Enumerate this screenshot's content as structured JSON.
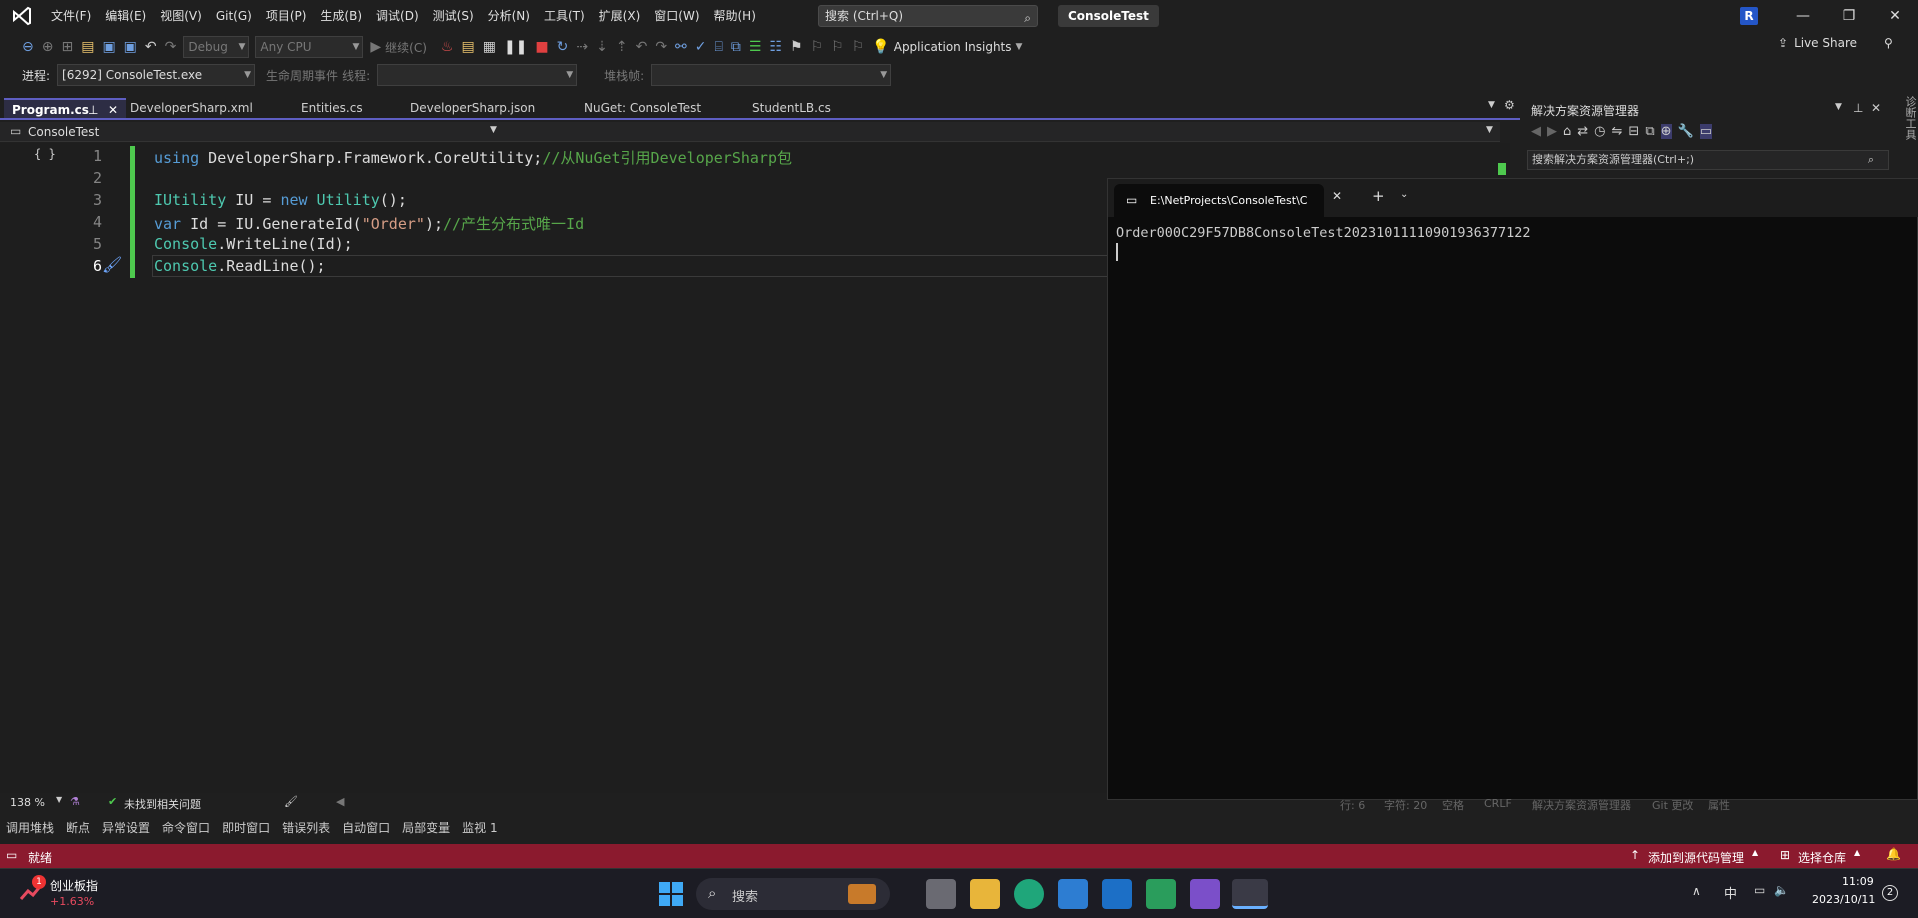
{
  "menu": [
    "文件(F)",
    "编辑(E)",
    "视图(V)",
    "Git(G)",
    "项目(P)",
    "生成(B)",
    "调试(D)",
    "测试(S)",
    "分析(N)",
    "工具(T)",
    "扩展(X)",
    "窗口(W)",
    "帮助(H)"
  ],
  "search": {
    "label": "搜索 (Ctrl+Q)"
  },
  "project_name": "ConsoleTest",
  "avatar_letter": "R",
  "toolbar": {
    "config": "Debug",
    "platform": "Any CPU",
    "continue": "继续(C)",
    "app_insights": "Application Insights",
    "live_share": "Live Share"
  },
  "debug_bar": {
    "process_label": "进程:",
    "process_value": "[6292] ConsoleTest.exe",
    "lifecycle": "生命周期事件",
    "thread_label": "线程:",
    "stackframe_label": "堆栈帧:"
  },
  "tabs": [
    "Program.cs",
    "DeveloperSharp.xml",
    "Entities.cs",
    "DeveloperSharp.json",
    "NuGet: ConsoleTest",
    "StudentLB.cs"
  ],
  "nav_project": "ConsoleTest",
  "code": {
    "line1": {
      "kw": "using",
      "ns": " DeveloperSharp.Framework.CoreUtility;",
      "comment": "//从NuGet引用DeveloperSharp包"
    },
    "line3": {
      "ty1": "IUtility",
      "mid": " IU = ",
      "kw": "new",
      "ty2": " Utility",
      "end": "();"
    },
    "line4": {
      "kw": "var",
      "mid": " Id = IU.GenerateId(",
      "str": "\"Order\"",
      "end": ");",
      "comment": "//产生分布式唯一Id"
    },
    "line5": {
      "ty": "Console",
      "rest": ".WriteLine(Id);"
    },
    "line6": {
      "ty": "Console",
      "rest": ".ReadLine();"
    },
    "line_numbers": [
      "1",
      "2",
      "3",
      "4",
      "5",
      "6"
    ]
  },
  "solution_explorer": {
    "title": "解决方案资源管理器",
    "search": "搜索解决方案资源管理器(Ctrl+;)"
  },
  "terminal": {
    "tab_title": "E:\\NetProjects\\ConsoleTest\\C",
    "output": "Order000C29F57DB8ConsoleTest20231011110901936377122"
  },
  "editor_status": {
    "zoom": "138 %",
    "issues": "未找到相关问题",
    "line": "行: 6",
    "col": "字符: 20",
    "space": "空格",
    "eol": "CRLF",
    "sln_tab": "解决方案资源管理器",
    "git_tab": "Git 更改",
    "props_tab": "属性"
  },
  "bottom_tabs": [
    "调用堆栈",
    "断点",
    "异常设置",
    "命令窗口",
    "即时窗口",
    "错误列表",
    "自动窗口",
    "局部变量",
    "监视 1"
  ],
  "status": {
    "ready": "就绪",
    "add_source": "添加到源代码管理",
    "select_repo": "选择仓库"
  },
  "taskbar": {
    "stock_name": "创业板指",
    "stock_change": "+1.63%",
    "stock_badge": "1",
    "search": "搜索",
    "ime": "中",
    "time": "11:09",
    "date": "2023/10/11",
    "notif_count": "2"
  },
  "colors": {
    "accent": "#5e5ec2",
    "statusbar": "#8b1a2e",
    "change_bar": "#4ec94e"
  }
}
